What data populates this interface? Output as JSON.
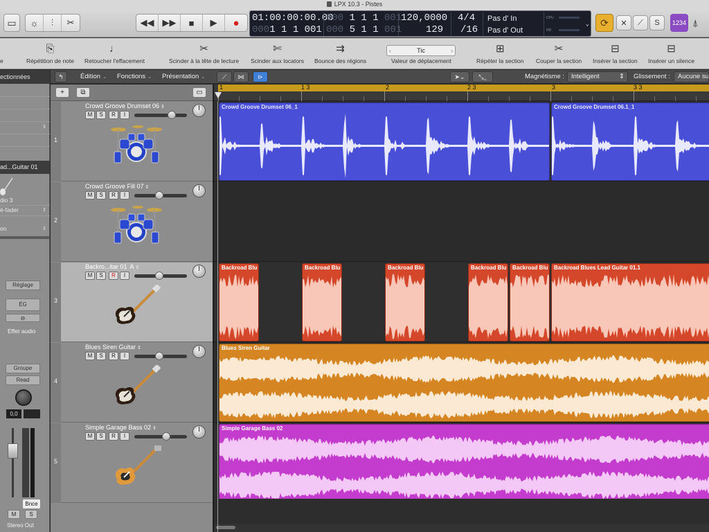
{
  "window": {
    "title": "LPX 10.3 - Pistes"
  },
  "lcd": {
    "position_time": [
      "01:00:00:00.00",
      "1 1 1 001"
    ],
    "position_time_dim": "001",
    "bars_top": "1  1  1",
    "bars_top_dim": "001",
    "bars_bottom": "5  1  1",
    "bars_bottom_dim": "001",
    "left_locator_prefix_dim": "000",
    "bars_bottom_prefix_dim": "000",
    "tempo": "120,0000",
    "tempo_bottom": "129",
    "signature": "4/4",
    "division": "/16",
    "in_label": "Pas d' In",
    "out_label": "Pas d' Out",
    "cpu_label": "CPU",
    "hd_label": "HD"
  },
  "controlbar": {
    "counter_label": "1234"
  },
  "toolbar": {
    "items": [
      {
        "label": "Répétition de note",
        "icon": "note-repeat-icon"
      },
      {
        "label": "Retoucher l'effacement",
        "icon": "quantize-erase-icon"
      },
      {
        "label": "Scinder à la tête de lecture",
        "icon": "split-playhead-icon"
      },
      {
        "label": "Scinder aux locators",
        "icon": "split-locators-icon"
      },
      {
        "label": "Bounce des régions",
        "icon": "bounce-regions-icon"
      },
      {
        "label": "Valeur de déplacement",
        "icon": "nudge-value-icon"
      },
      {
        "label": "Répéter la section",
        "icon": "repeat-section-icon"
      },
      {
        "label": "Couper la section",
        "icon": "cut-section-icon"
      },
      {
        "label": "Insérer la section",
        "icon": "insert-section-icon"
      },
      {
        "label": "Insérer un silence",
        "icon": "insert-silence-icon"
      }
    ],
    "nudge_value": "Tic",
    "partial_left_label": "e"
  },
  "inspector": {
    "header": "ectionnées",
    "strip_name": "ad...Guitar 01",
    "rows": [
      "dio 3",
      "é-fader",
      "on"
    ],
    "setting_label": "Réglage",
    "eq_label": "ÉG",
    "effects_label": "Effet audio",
    "group_label": "Groupe",
    "automation_label": "Read",
    "pan_value": "0,0",
    "bounce_label": "Bnce",
    "mute_label": "M",
    "solo_label": "S",
    "output_label": "Stereo Out"
  },
  "localbar": {
    "edit_menu": "Édition",
    "functions_menu": "Fonctions",
    "view_menu": "Présentation",
    "snap_label": "Magnétisme :",
    "snap_value": "Intelligent",
    "drag_label": "Glissement :",
    "drag_value": "Aucune su"
  },
  "ruler": {
    "bars": [
      "1",
      "1 3",
      "2",
      "2 3",
      "3",
      "3 3"
    ]
  },
  "tracks": [
    {
      "number": "1",
      "name": "Crowd Groove Drumset 06",
      "icon": "drum-kit-icon",
      "selected": false,
      "armed": false,
      "volume": 0.75
    },
    {
      "number": "2",
      "name": "Crowd Groove Fill 07",
      "icon": "drum-kit-icon",
      "selected": false,
      "armed": false,
      "volume": 0.47
    },
    {
      "number": "3",
      "name": "Backro...itar 01",
      "icon": "electric-guitar-icon",
      "selected": true,
      "armed": true,
      "input": "A",
      "volume": 0.47
    },
    {
      "number": "4",
      "name": "Blues Siren Guitar",
      "icon": "electric-guitar-icon",
      "selected": false,
      "armed": false,
      "volume": 0.47
    },
    {
      "number": "5",
      "name": "Simple Garage Bass 02",
      "icon": "bass-guitar-icon",
      "selected": false,
      "armed": false,
      "volume": 0.63
    }
  ],
  "regions": [
    {
      "lane": 0,
      "name": "Crowd Groove Drumset 06_1",
      "start": 0,
      "end": 2,
      "color": "#4a4fd8",
      "wave": "#e8e9ff",
      "kind": "drum"
    },
    {
      "lane": 0,
      "name": "Crowd Groove Drumset 06.1_1",
      "start": 2,
      "end": 3,
      "color": "#4a4fd8",
      "wave": "#e8e9ff",
      "kind": "drum"
    },
    {
      "lane": 2,
      "name": "Backroad Blu",
      "start": 0,
      "end": 0.25,
      "color": "#d4472a",
      "wave": "#f9c7b8",
      "kind": "dense"
    },
    {
      "lane": 2,
      "name": "Backroad Blu",
      "start": 0.5,
      "end": 0.75,
      "color": "#d4472a",
      "wave": "#f9c7b8",
      "kind": "dense"
    },
    {
      "lane": 2,
      "name": "Backroad Blu",
      "start": 1,
      "end": 1.25,
      "color": "#d4472a",
      "wave": "#f9c7b8",
      "kind": "dense"
    },
    {
      "lane": 2,
      "name": "Backroad Blu",
      "start": 1.5,
      "end": 1.75,
      "color": "#d4472a",
      "wave": "#f9c7b8",
      "kind": "dense"
    },
    {
      "lane": 2,
      "name": "Backroad Blu",
      "start": 1.75,
      "end": 2,
      "color": "#d4472a",
      "wave": "#f9c7b8",
      "kind": "dense"
    },
    {
      "lane": 2,
      "name": "Backroad Blues Lead Guitar 01.1",
      "start": 2,
      "end": 3,
      "color": "#d4472a",
      "wave": "#f9c7b8",
      "kind": "dense"
    },
    {
      "lane": 3,
      "name": "Blues Siren Guitar",
      "start": 0,
      "end": 3,
      "color": "#d58623",
      "wave": "#fbe9d4",
      "kind": "sustain"
    },
    {
      "lane": 4,
      "name": "Simple Garage Bass 02",
      "start": 0,
      "end": 3,
      "color": "#c43ccd",
      "wave": "#f4c8f6",
      "kind": "sustain"
    }
  ],
  "colors": {
    "cycle": "#c59a1d",
    "lcd_bg": "#1b1e29",
    "accent_purple": "#8b4bc2"
  }
}
